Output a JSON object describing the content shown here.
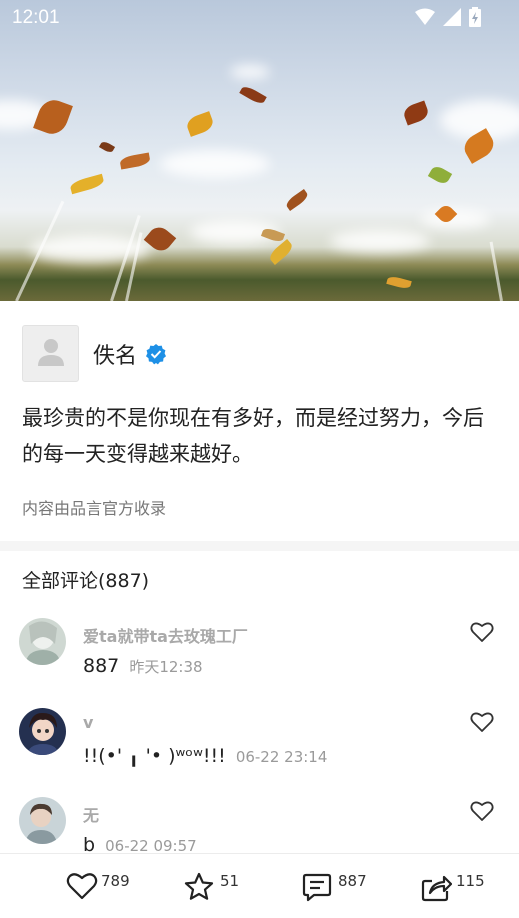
{
  "status_bar": {
    "time": "12:01"
  },
  "author": {
    "name": "佚名",
    "verified": true
  },
  "quote": {
    "text": "最珍贵的不是你现在有多好，而是经过努力，今后的每一天变得越来越好。"
  },
  "source": {
    "text": "内容由品言官方收录"
  },
  "comments": {
    "title": "全部评论(887)",
    "items": [
      {
        "name": "爱ta就带ta去玫瑰工厂",
        "text": "887",
        "time": "昨天12:38"
      },
      {
        "name": "v",
        "text": "!!(•' ╻ '• )ʷᵒʷ!!!",
        "time": "06-22 23:14"
      },
      {
        "name": "无",
        "text": "b",
        "time": "06-22 09:57"
      }
    ]
  },
  "actions": {
    "likes": "789",
    "favorites": "51",
    "comments": "887",
    "shares": "115"
  },
  "colors": {
    "verified_blue": "#1e90e6",
    "muted_text": "#9a9a9a"
  }
}
